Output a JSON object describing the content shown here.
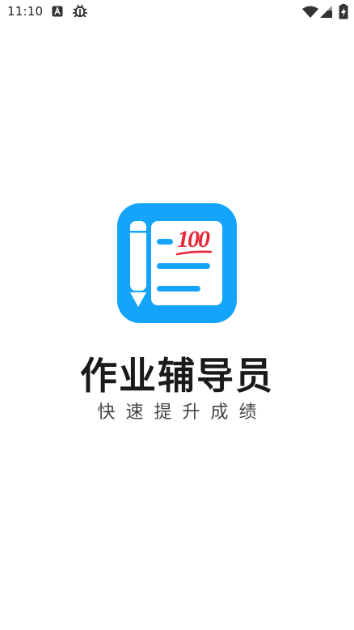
{
  "status_bar": {
    "time": "11:10",
    "left_icons": [
      "notification-a-icon",
      "bug-icon"
    ],
    "right_icons": [
      "wifi-icon",
      "signal-icon",
      "battery-charging-icon"
    ]
  },
  "splash": {
    "logo_icon": "notebook-100-score-icon",
    "logo_text": "100",
    "app_name": "作业辅导员",
    "slogan": "快速提升成绩",
    "colors": {
      "logo_background": "#14a4fb",
      "logo_score": "#e8293a",
      "app_name": "#1a1a1a",
      "slogan": "#444444"
    }
  }
}
